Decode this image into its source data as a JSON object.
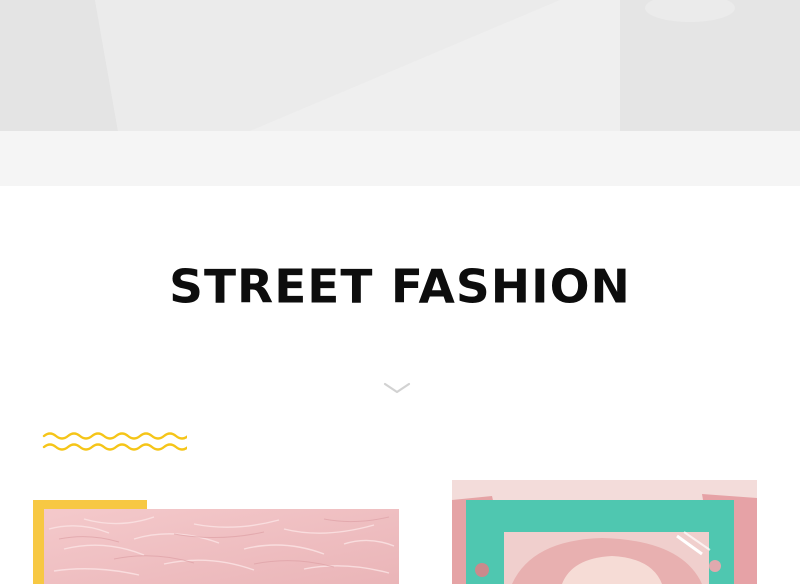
{
  "section": {
    "title": "STREET FASHION"
  },
  "icons": {
    "scroll_indicator": "chevron-down-icon",
    "decoration": "wavy-lines-icon"
  },
  "colors": {
    "accent_yellow": "#f7c843",
    "title_text": "#0d0d0d",
    "pink": "#f2c4c6",
    "teal": "#4fc7b0"
  }
}
